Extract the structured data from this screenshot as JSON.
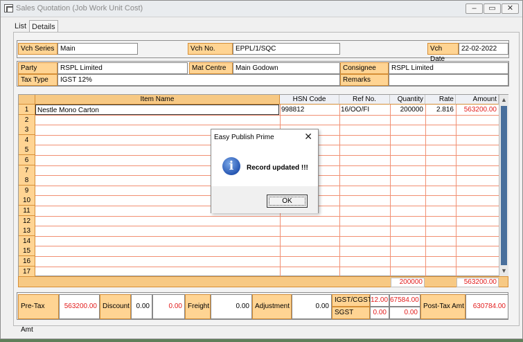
{
  "window": {
    "title": "Sales Quotation (Job Work Unit Cost)",
    "buttons": {
      "minimize": "–",
      "restore": "▭",
      "close": "✕"
    }
  },
  "tabs": [
    {
      "label": "List"
    },
    {
      "label": "Details"
    }
  ],
  "header": {
    "vch_series_label": "Vch Series",
    "vch_series": "Main",
    "vch_no_label": "Vch No.",
    "vch_no": "EPPL/1/SQC",
    "vch_date_label": "Vch Date",
    "vch_date": "22-02-2022"
  },
  "party": {
    "party_label": "Party",
    "party": "RSPL Limited",
    "mat_centre_label": "Mat Centre",
    "mat_centre": "Main Godown",
    "consignee_label": "Consignee",
    "consignee": "RSPL Limited",
    "tax_type_label": "Tax Type",
    "tax_type": "IGST 12%",
    "remarks_label": "Remarks",
    "remarks": ""
  },
  "grid": {
    "columns": [
      "Item Name",
      "HSN Code",
      "Ref No.",
      "Quantity",
      "Rate",
      "Amount"
    ],
    "row_numbers": [
      "1",
      "2",
      "3",
      "4",
      "5",
      "6",
      "7",
      "8",
      "9",
      "10",
      "11",
      "12",
      "13",
      "14",
      "15",
      "16",
      "17"
    ],
    "rows": [
      {
        "item": "Nestle Mono Carton",
        "hsn": "998812",
        "ref": "16/OO/FI",
        "qty": "200000",
        "rate": "2.816",
        "amount": "563200.00"
      }
    ],
    "totals": {
      "quantity": "200000",
      "amount": "563200.00"
    }
  },
  "footer": {
    "pre_tax_label": "Pre-Tax Amt",
    "pre_tax": "563200.00",
    "discount_label": "Discount",
    "discount_pct": "0.00",
    "discount_amt": "0.00",
    "freight_label": "Freight",
    "freight": "0.00",
    "adjustment_label": "Adjustment",
    "adjustment": "0.00",
    "igst_label": "IGST/CGST",
    "igst_pct": "12.00",
    "igst_amt": "67584.00",
    "sgst_label": "SGST",
    "sgst_pct": "0.00",
    "sgst_amt": "0.00",
    "post_tax_label": "Post-Tax Amt",
    "post_tax": "630784.00"
  },
  "dialog": {
    "title": "Easy Publish Prime",
    "close": "✕",
    "icon": "info-icon",
    "message": "Record updated !!!",
    "ok": "OK"
  }
}
